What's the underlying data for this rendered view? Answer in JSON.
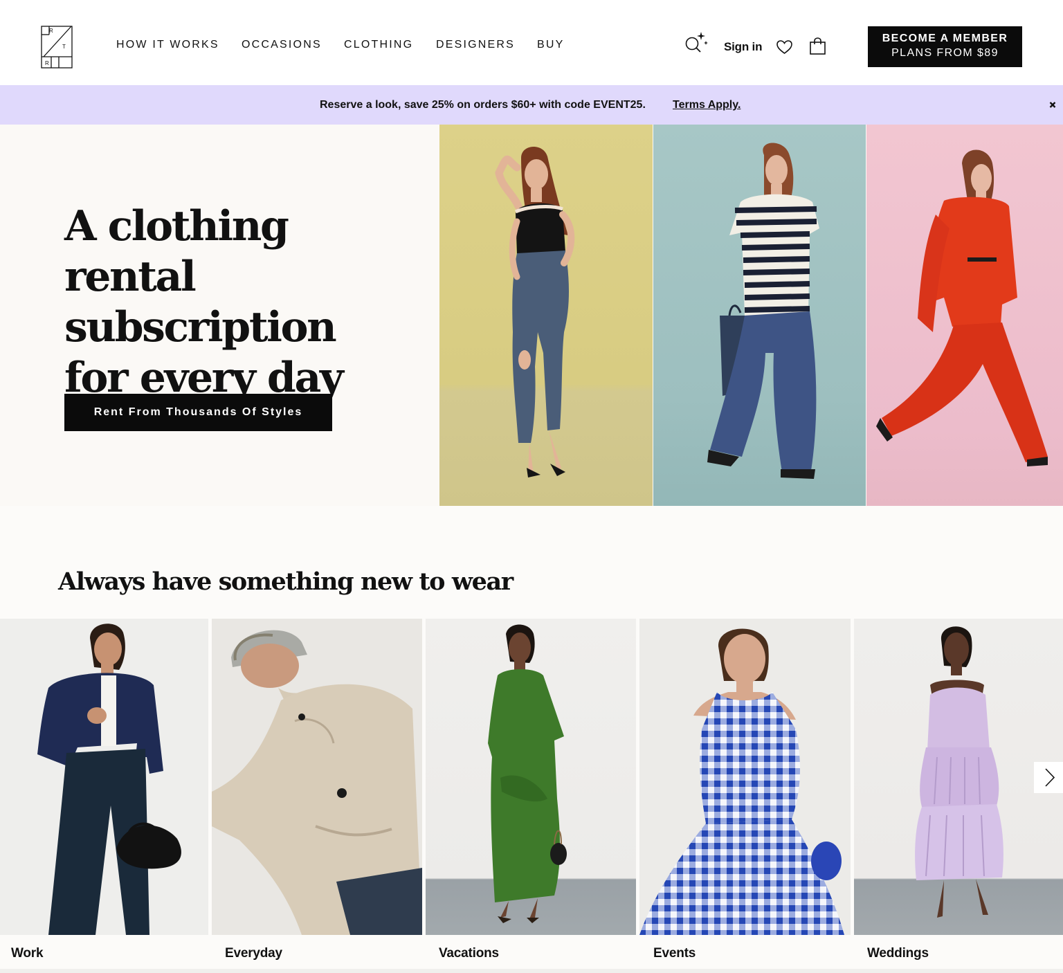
{
  "logo": {
    "letters": [
      "R",
      "T",
      "R"
    ]
  },
  "nav": {
    "how_it_works": "HOW IT WORKS",
    "occasions": "OCCASIONS",
    "clothing": "CLOTHING",
    "designers": "DESIGNERS",
    "buy": "BUY"
  },
  "header": {
    "search_icon": "sparkle-search-icon",
    "sign_in": "Sign in",
    "heart_icon": "heart-icon",
    "bag_icon": "shopping-bag-icon",
    "member_line1": "BECOME A MEMBER",
    "member_line2": "PLANS FROM $89"
  },
  "promo": {
    "text": "Reserve a look, save 25% on orders $60+ with code EVENT25.",
    "link": "Terms Apply.",
    "close_icon": "close-icon",
    "background": "#e0d9fc"
  },
  "hero": {
    "title": "A clothing rental subscription for every day",
    "cta": "Rent From Thousands Of Styles"
  },
  "section": {
    "title": "Always have something new to wear",
    "tiles": [
      {
        "label": "Work"
      },
      {
        "label": "Everyday"
      },
      {
        "label": "Vacations"
      },
      {
        "label": "Events"
      },
      {
        "label": "Weddings"
      }
    ],
    "next_icon": "chevron-right-icon"
  }
}
